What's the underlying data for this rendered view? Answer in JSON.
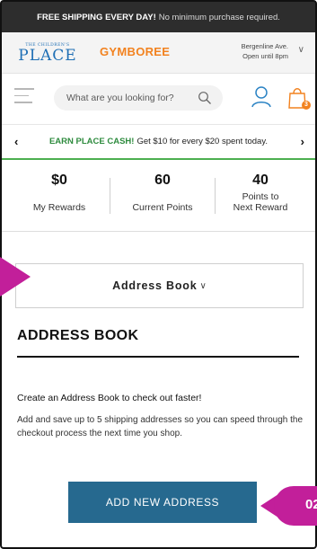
{
  "banner": {
    "bold": "FREE SHIPPING EVERY DAY!",
    "rest": "No minimum purchase required."
  },
  "brands": {
    "place_small": "THE CHILDREN'S",
    "place_big": "PLACE",
    "gymboree": "GYMBOREE"
  },
  "store": {
    "name": "Bergenline Ave.",
    "hours": "Open until 8pm"
  },
  "search": {
    "placeholder": "What are you looking for?"
  },
  "bag": {
    "count": "3"
  },
  "promo": {
    "highlight": "EARN PLACE CASH!",
    "text": "Get $10 for every $20 spent today."
  },
  "rewards": {
    "my_rewards_value": "$0",
    "my_rewards_label": "My Rewards",
    "current_points_value": "60",
    "current_points_label": "Current Points",
    "next_reward_value": "40",
    "next_reward_label_1": "Points to",
    "next_reward_label_2": "Next Reward"
  },
  "dropdown": {
    "label": "Address Book"
  },
  "address_book": {
    "heading": "ADDRESS BOOK",
    "intro_bold": "Create an Address Book to check out faster!",
    "intro_text": "Add and save up to 5 shipping addresses so you can speed through the checkout process the next time you shop.",
    "add_button": "ADD NEW ADDRESS"
  },
  "callout": {
    "number": "02"
  },
  "colors": {
    "accent_green": "#4caf50",
    "button_blue": "#26698f",
    "callout_magenta": "#c21f9a",
    "gymboree_orange": "#f2821f",
    "place_blue": "#1f6fb5"
  }
}
